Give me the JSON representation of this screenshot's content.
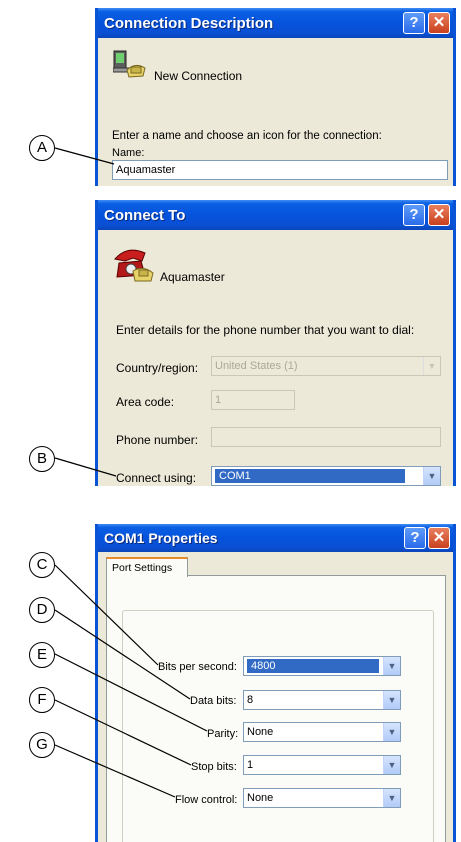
{
  "dialog1": {
    "title": "Connection Description",
    "icon_label": "New Connection",
    "instruction": "Enter a name and choose an icon for the connection:",
    "name_label": "Name:",
    "name_value": "Aquamaster"
  },
  "dialog2": {
    "title": "Connect To",
    "icon_label": "Aquamaster",
    "instruction": "Enter details for the phone number that you want to dial:",
    "country_label": "Country/region:",
    "country_value": "United States (1)",
    "area_label": "Area code:",
    "area_value": "1",
    "phone_label": "Phone number:",
    "phone_value": "",
    "connect_label": "Connect using:",
    "connect_value": "COM1"
  },
  "dialog3": {
    "title": "COM1 Properties",
    "tab": "Port Settings",
    "bits_label": "Bits per second:",
    "bits_value": "4800",
    "data_label": "Data bits:",
    "data_value": "8",
    "parity_label": "Parity:",
    "parity_value": "None",
    "stop_label": "Stop bits:",
    "stop_value": "1",
    "flow_label": "Flow control:",
    "flow_value": "None"
  },
  "title_buttons": {
    "help": "?",
    "close": "✕"
  },
  "callouts": [
    "A",
    "B",
    "C",
    "D",
    "E",
    "F",
    "G"
  ],
  "colors": {
    "title_bar": "#0553dd",
    "dialog_bg": "#ece9d8",
    "selection": "#316ac5"
  },
  "icons": [
    "computer-phone-icon",
    "phone-icon",
    "help-icon",
    "close-icon",
    "dropdown-arrow-icon"
  ]
}
